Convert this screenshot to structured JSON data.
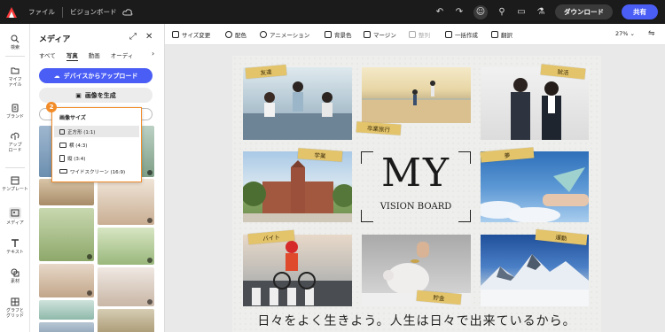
{
  "topbar": {
    "file_menu": "ファイル",
    "doc_title": "ビジョンボード",
    "download": "ダウンロード",
    "share": "共有"
  },
  "rail": [
    {
      "label": "検索",
      "icon": "search-icon"
    },
    {
      "label": "マイファイル",
      "icon": "folder-icon"
    },
    {
      "label": "ブランド",
      "icon": "brand-icon"
    },
    {
      "label": "アップロード",
      "icon": "upload-icon"
    },
    {
      "label": "テンプレート",
      "icon": "template-icon"
    },
    {
      "label": "メディア",
      "icon": "media-icon"
    },
    {
      "label": "テキスト",
      "icon": "text-icon"
    },
    {
      "label": "素材",
      "icon": "elements-icon"
    },
    {
      "label": "グラフとグリッド",
      "icon": "grid-icon"
    }
  ],
  "panel": {
    "title": "メディア",
    "tabs": [
      "すべて",
      "写真",
      "動画",
      "オーディ"
    ],
    "active_tab": "写真",
    "upload_label": "デバイスからアップロード",
    "generate_label": "画像を生成"
  },
  "popup": {
    "step": "2",
    "title": "画像サイズ",
    "options": [
      "正方形 (1:1)",
      "横 (4:3)",
      "縦 (3:4)",
      "ワイドスクリーン (16:9)"
    ],
    "selected": "正方形 (1:1)"
  },
  "toolbar": {
    "items": [
      "サイズ変更",
      "配色",
      "アニメーション",
      "背景色",
      "マージン",
      "整列",
      "一括作成",
      "翻訳"
    ],
    "disabled": [
      "整列"
    ],
    "zoom": "27%"
  },
  "board": {
    "title": "MY",
    "subtitle": "VISION BOARD",
    "slogan": "日々をよく生きよう。人生は日々で出来ているから。",
    "labels": [
      "友達",
      "卒業旅行",
      "就活",
      "学業",
      "夢",
      "バイト",
      "貯金",
      "運動"
    ]
  },
  "colors": {
    "accent": "#4a5df5",
    "highlight": "#f28c28",
    "tape": "#e3c46b",
    "topbar": "#1b1b1b"
  }
}
